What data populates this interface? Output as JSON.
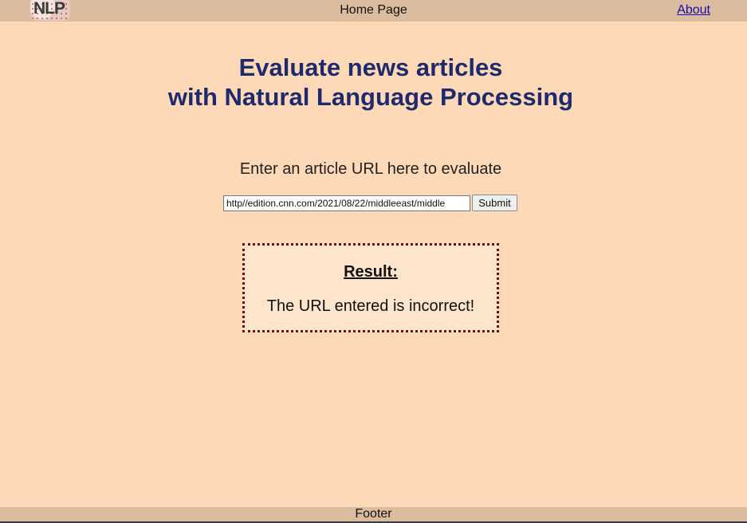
{
  "header": {
    "logo_text": "NLP",
    "title": "Home Page",
    "about_link": "About"
  },
  "main": {
    "heading_line1": "Evaluate news articles",
    "heading_line2": "with Natural Language Processing",
    "prompt": "Enter an article URL here to evaluate",
    "url_value": "http//edition.cnn.com/2021/08/22/middleeast/middle",
    "submit_label": "Submit"
  },
  "result": {
    "title": "Result:",
    "message": "The URL entered is incorrect!"
  },
  "footer": {
    "text": "Footer"
  }
}
